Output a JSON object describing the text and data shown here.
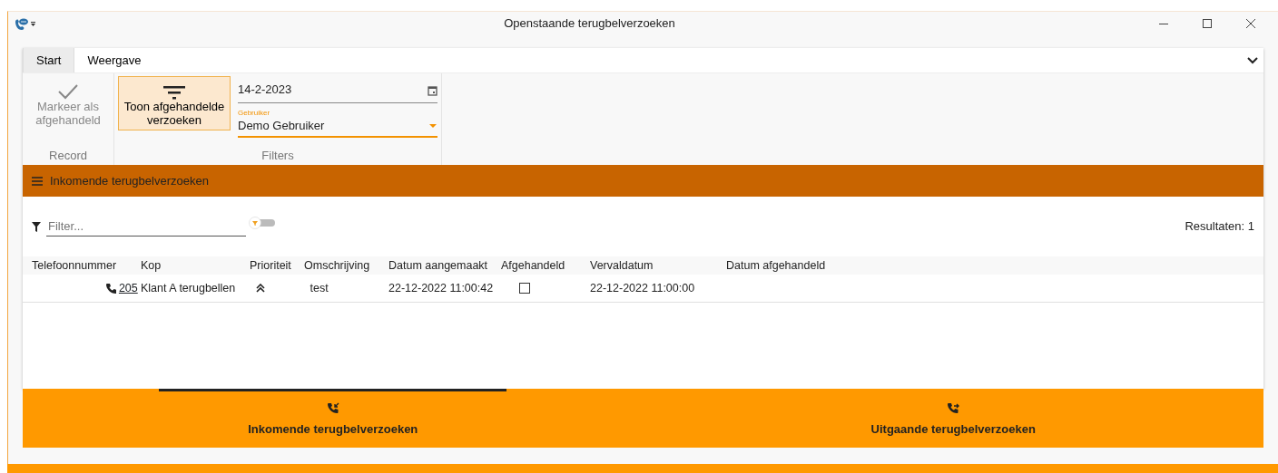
{
  "window": {
    "title": "Openstaande terugbelverzoeken"
  },
  "tabs": [
    {
      "label": "Start",
      "selected": true
    },
    {
      "label": "Weergave",
      "selected": false
    }
  ],
  "ribbon": {
    "groups": [
      {
        "label": "Record",
        "kind": "record",
        "button": {
          "label": "Markeer als afgehandeld",
          "disabled": true
        }
      },
      {
        "label": "Filters",
        "kind": "filters",
        "button": {
          "label": "Toon afgehandelde verzoeken",
          "selected": true
        },
        "date": "14-2-2023",
        "user_label": "Gebruiker",
        "user": "Demo Gebruiker"
      }
    ]
  },
  "section": {
    "title": "Inkomende terugbelverzoeken"
  },
  "filter": {
    "placeholder": "Filter...",
    "toggle_on": false,
    "results": "Resultaten: 1"
  },
  "table": {
    "columns": [
      "Telefoonnummer",
      "Kop",
      "Prioriteit",
      "Omschrijving",
      "Datum aangemaakt",
      "Afgehandeld",
      "Vervaldatum",
      "Datum afgehandeld"
    ],
    "rows": [
      {
        "phone": "205",
        "title": "Klant A terugbellen",
        "priority_high": true,
        "description": "test",
        "created": "22-12-2022 11:00:42",
        "done": false,
        "due": "22-12-2022 11:00:00"
      }
    ]
  },
  "bottom_tabs": [
    {
      "label": "Inkomende terugbelverzoeken",
      "kind": "incoming",
      "selected": true
    },
    {
      "label": "Uitgaande terugbelverzoeken",
      "kind": "outgoing",
      "selected": false
    }
  ]
}
